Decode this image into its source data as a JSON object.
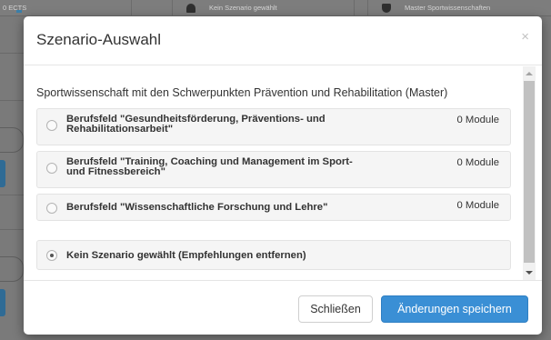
{
  "background": {
    "ects_label": "0 ECTS",
    "scenario_status": "Kein Szenario gewählt",
    "program": "Master Sportwissenschaften"
  },
  "modal": {
    "title": "Szenario-Auswahl",
    "close_symbol": "×",
    "subtitle": "Sportwissenschaft mit den Schwerpunkten Prävention und Rehabilitation (Master)",
    "options": [
      {
        "label": "Berufsfeld \"Gesundheitsförderung, Präventions- und Rehabilitationsarbeit\"",
        "count": "0 Module",
        "selected": false
      },
      {
        "label": "Berufsfeld \"Training, Coaching und Management im Sport- und Fitnessbereich\"",
        "count": "0 Module",
        "selected": false
      },
      {
        "label": "Berufsfeld \"Wissenschaftliche Forschung und Lehre\"",
        "count": "0 Module",
        "selected": false
      },
      {
        "label": "Kein Szenario gewählt (Empfehlungen entfernen)",
        "count": "",
        "selected": true
      }
    ],
    "buttons": {
      "close_label": "Schließen",
      "save_label": "Änderungen speichern"
    }
  },
  "icons": [
    "person-icon",
    "shield-icon",
    "close-icon",
    "scroll-up-icon",
    "scroll-down-icon"
  ],
  "colors": {
    "primary_button": "#3a8fd5",
    "overlay": "#7a7a7a",
    "option_bg": "#f5f5f5"
  }
}
